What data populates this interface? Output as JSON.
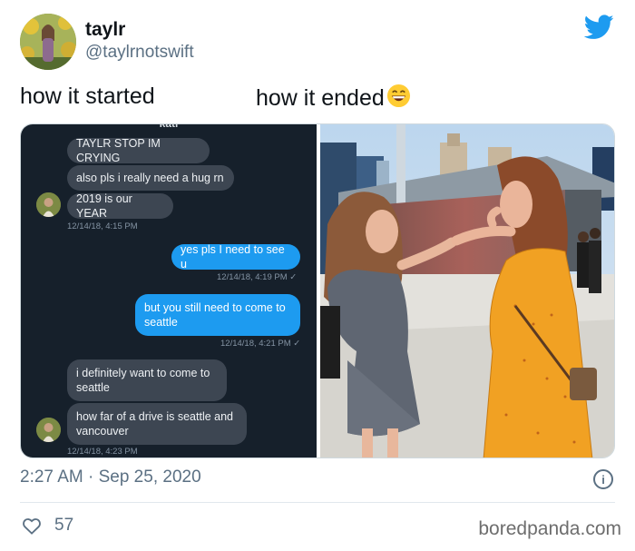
{
  "author": {
    "display_name": "taylr",
    "handle": "@taylrnotswift"
  },
  "tweet": {
    "caption_left": "how it started",
    "caption_right": "how it ended",
    "emoji": "grinning-face-with-smiling-eyes",
    "timestamp": "2:27 AM · Sep 25, 2020",
    "likes": "57"
  },
  "chat": {
    "contact_name": "kati",
    "messages": [
      {
        "text": "TAYLR STOP IM CRYING"
      },
      {
        "text": "also pls i really need a hug rn"
      },
      {
        "text": "2019 is our YEAR"
      },
      {
        "text": "12/14/18, 4:15 PM"
      },
      {
        "text": "yes pls I need to see u"
      },
      {
        "text": "12/14/18, 4:19 PM ✓"
      },
      {
        "text": "but you still need to come to seattle"
      },
      {
        "text": "12/14/18, 4:21 PM ✓"
      },
      {
        "text": "i definitely want to come to seattle"
      },
      {
        "text": "how far of a drive is seattle and vancouver"
      },
      {
        "text": "12/14/18, 4:23 PM"
      }
    ]
  },
  "watermark": "boredpanda.com",
  "colors": {
    "twitter_blue": "#1d9bf0",
    "chat_background": "#16202b",
    "incoming_bubble": "#3d4652",
    "outgoing_bubble": "#1d9bf0",
    "muted_text": "#5b7083",
    "dress_orange": "#f1a123"
  },
  "icons": [
    "twitter-bird-icon",
    "info-icon",
    "heart-icon"
  ]
}
